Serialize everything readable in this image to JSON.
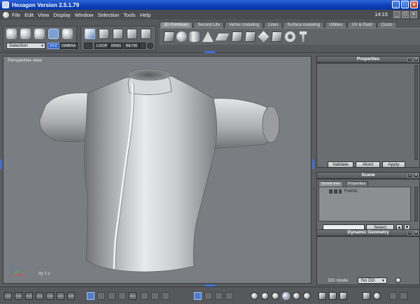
{
  "window": {
    "title": "Hexagon Version 2.5.1.79",
    "controls": [
      "_",
      "□",
      "×"
    ]
  },
  "menu": {
    "items": [
      "File",
      "Edit",
      "View",
      "Display",
      "Window",
      "Selection",
      "Tools",
      "Help"
    ],
    "clock": "14:15",
    "controls": [
      "_",
      "□",
      "×"
    ]
  },
  "toolbar": {
    "selection_dropdown": "Selection",
    "axis_buttons": [
      "XYZ",
      "OMBRA"
    ],
    "select_modes": [
      "LOOP",
      "RING",
      "BETW"
    ],
    "tabs": [
      "3D Primitives",
      "Second Life",
      "Vertex modeling",
      "Lines",
      "Surface modeling",
      "Utilities",
      "UV & Paint",
      "Custo"
    ],
    "active_tab": "3D Primitives",
    "primitives": [
      "cube-icon",
      "sphere-icon",
      "cylinder-icon",
      "cone-icon",
      "plane-icon",
      "cube-icon",
      "cube-icon",
      "diamond-icon",
      "torus-icon",
      "hammer-icon"
    ]
  },
  "viewport": {
    "label": "Perspective view",
    "axis_label": "try 1 u"
  },
  "properties_panel": {
    "title": "Properties",
    "buttons": [
      "Validate",
      "Abort",
      "Apply"
    ]
  },
  "scene_panel": {
    "title": "Scene",
    "tabs": [
      "Scene tree",
      "Properties"
    ],
    "tree_items": [
      "Form1"
    ],
    "select_button": "Select",
    "arrow_buttons": [
      "▲",
      "▼"
    ]
  },
  "dg_panel": {
    "title": "Dynamic Geometry",
    "mode_label": "DG mode:",
    "mode_value": "No DG"
  },
  "colors": {
    "ui_gray": "#56585c",
    "viewport": "#7a7d81",
    "accent_blue": "#3b70d6",
    "titlebar": "#0a3fb8"
  }
}
